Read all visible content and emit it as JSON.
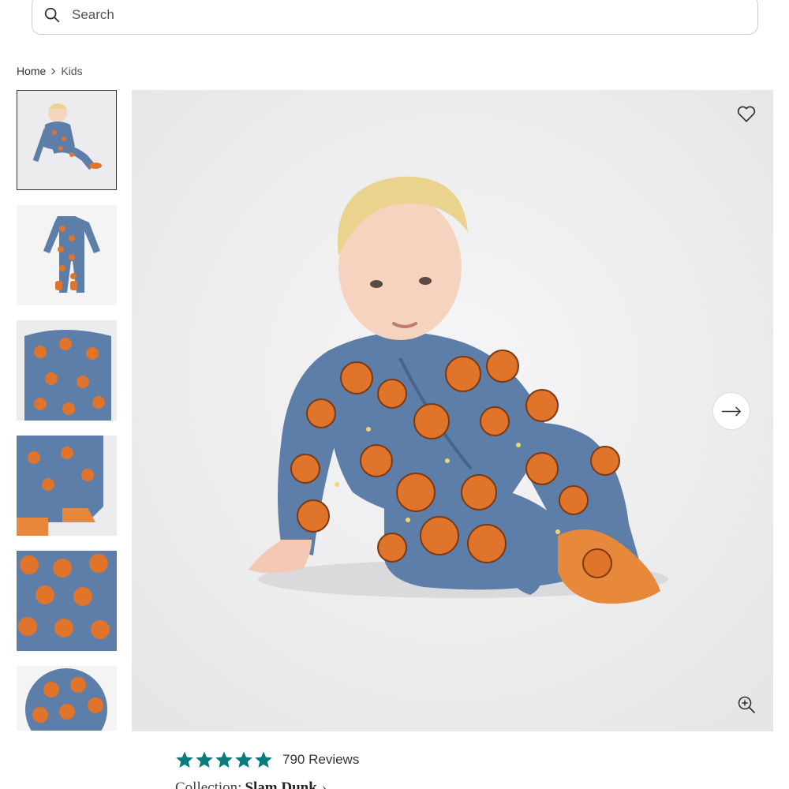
{
  "search": {
    "placeholder": "Search",
    "icon": "search-icon"
  },
  "breadcrumb": {
    "home": "Home",
    "current": "Kids"
  },
  "gallery": {
    "thumbnails": [
      {
        "name": "thumb-baby-sitting",
        "active": true
      },
      {
        "name": "thumb-flat-footie",
        "active": false
      },
      {
        "name": "thumb-closeup-zipper",
        "active": false
      },
      {
        "name": "thumb-closeup-feet",
        "active": false
      },
      {
        "name": "thumb-print-swatch",
        "active": false
      },
      {
        "name": "thumb-print-circle",
        "active": false
      }
    ],
    "icons": {
      "wishlist": "heart-icon",
      "next": "arrow-right-icon",
      "zoom": "zoom-in-icon"
    }
  },
  "reviews": {
    "rating": 5,
    "count_label": "790 Reviews",
    "star_color": "#0d7b7c"
  },
  "collection": {
    "label": "Collection:",
    "name": "Slam Dunk"
  },
  "colors": {
    "fabric_blue": "#5d7ea8",
    "basketball_orange": "#e0742a",
    "accent_teal": "#0d7b7c"
  }
}
